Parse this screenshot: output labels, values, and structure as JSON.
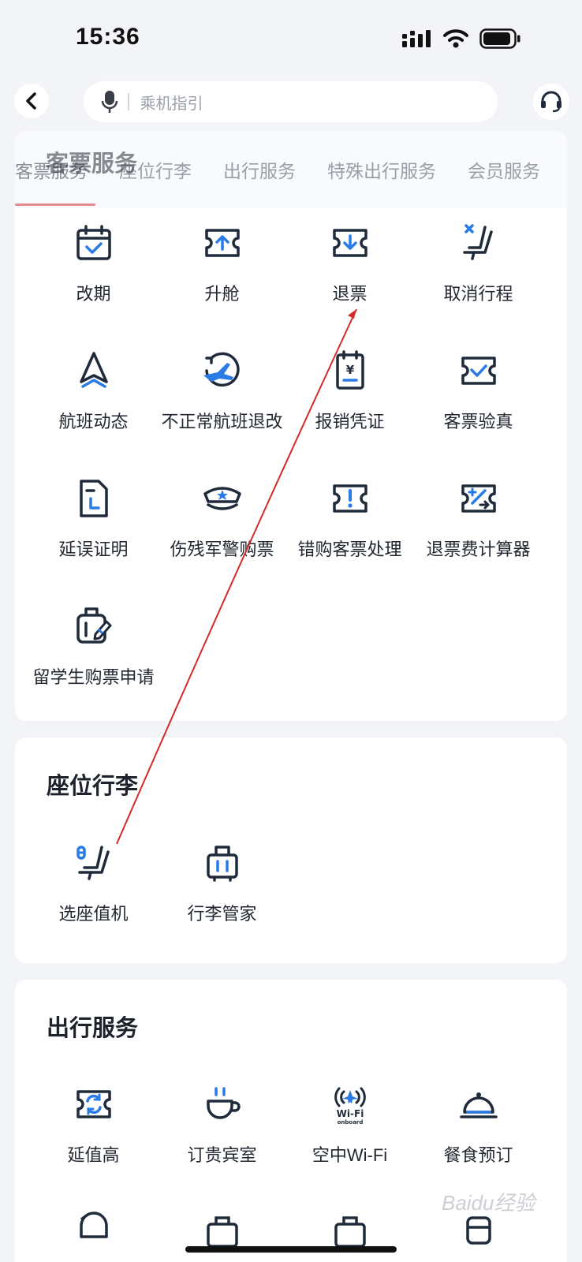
{
  "status_bar": {
    "time": "15:36"
  },
  "search": {
    "placeholder": "乘机指引"
  },
  "tabs": [
    "客票服务",
    "座位行李",
    "出行服务",
    "特殊出行服务",
    "会员服务"
  ],
  "sections": {
    "ticket": {
      "title": "客票服务",
      "items": [
        {
          "label": "改期",
          "icon": "calendar-check-icon"
        },
        {
          "label": "升舱",
          "icon": "ticket-upgrade-icon"
        },
        {
          "label": "退票",
          "icon": "ticket-refund-icon"
        },
        {
          "label": "取消行程",
          "icon": "seat-cancel-icon"
        },
        {
          "label": "航班动态",
          "icon": "flight-status-icon"
        },
        {
          "label": "不正常航班退改",
          "icon": "irregular-flight-icon"
        },
        {
          "label": "报销凭证",
          "icon": "receipt-icon"
        },
        {
          "label": "客票验真",
          "icon": "ticket-verify-icon"
        },
        {
          "label": "延误证明",
          "icon": "delay-certificate-icon"
        },
        {
          "label": "伤残军警购票",
          "icon": "military-police-icon"
        },
        {
          "label": "错购客票处理",
          "icon": "ticket-error-icon"
        },
        {
          "label": "退票费计算器",
          "icon": "fee-calculator-icon"
        },
        {
          "label": "留学生购票申请",
          "icon": "student-luggage-icon"
        }
      ]
    },
    "seat": {
      "title": "座位行李",
      "items": [
        {
          "label": "选座值机",
          "icon": "seat-checkin-icon"
        },
        {
          "label": "行李管家",
          "icon": "luggage-icon"
        }
      ]
    },
    "travel": {
      "title": "出行服务",
      "items": [
        {
          "label": "延值高",
          "icon": "upgrade-ticket-icon"
        },
        {
          "label": "订贵宾室",
          "icon": "lounge-cup-icon"
        },
        {
          "label": "空中Wi-Fi",
          "icon": "wifi-onboard-icon"
        },
        {
          "label": "餐食预订",
          "icon": "meal-cloche-icon"
        }
      ]
    }
  },
  "watermark": "Baidu经验",
  "colors": {
    "primary": "#1f2a3a",
    "accent": "#2b7be6",
    "tab_underline": "#e58a8f",
    "annotation_arrow": "#d42a2a"
  }
}
